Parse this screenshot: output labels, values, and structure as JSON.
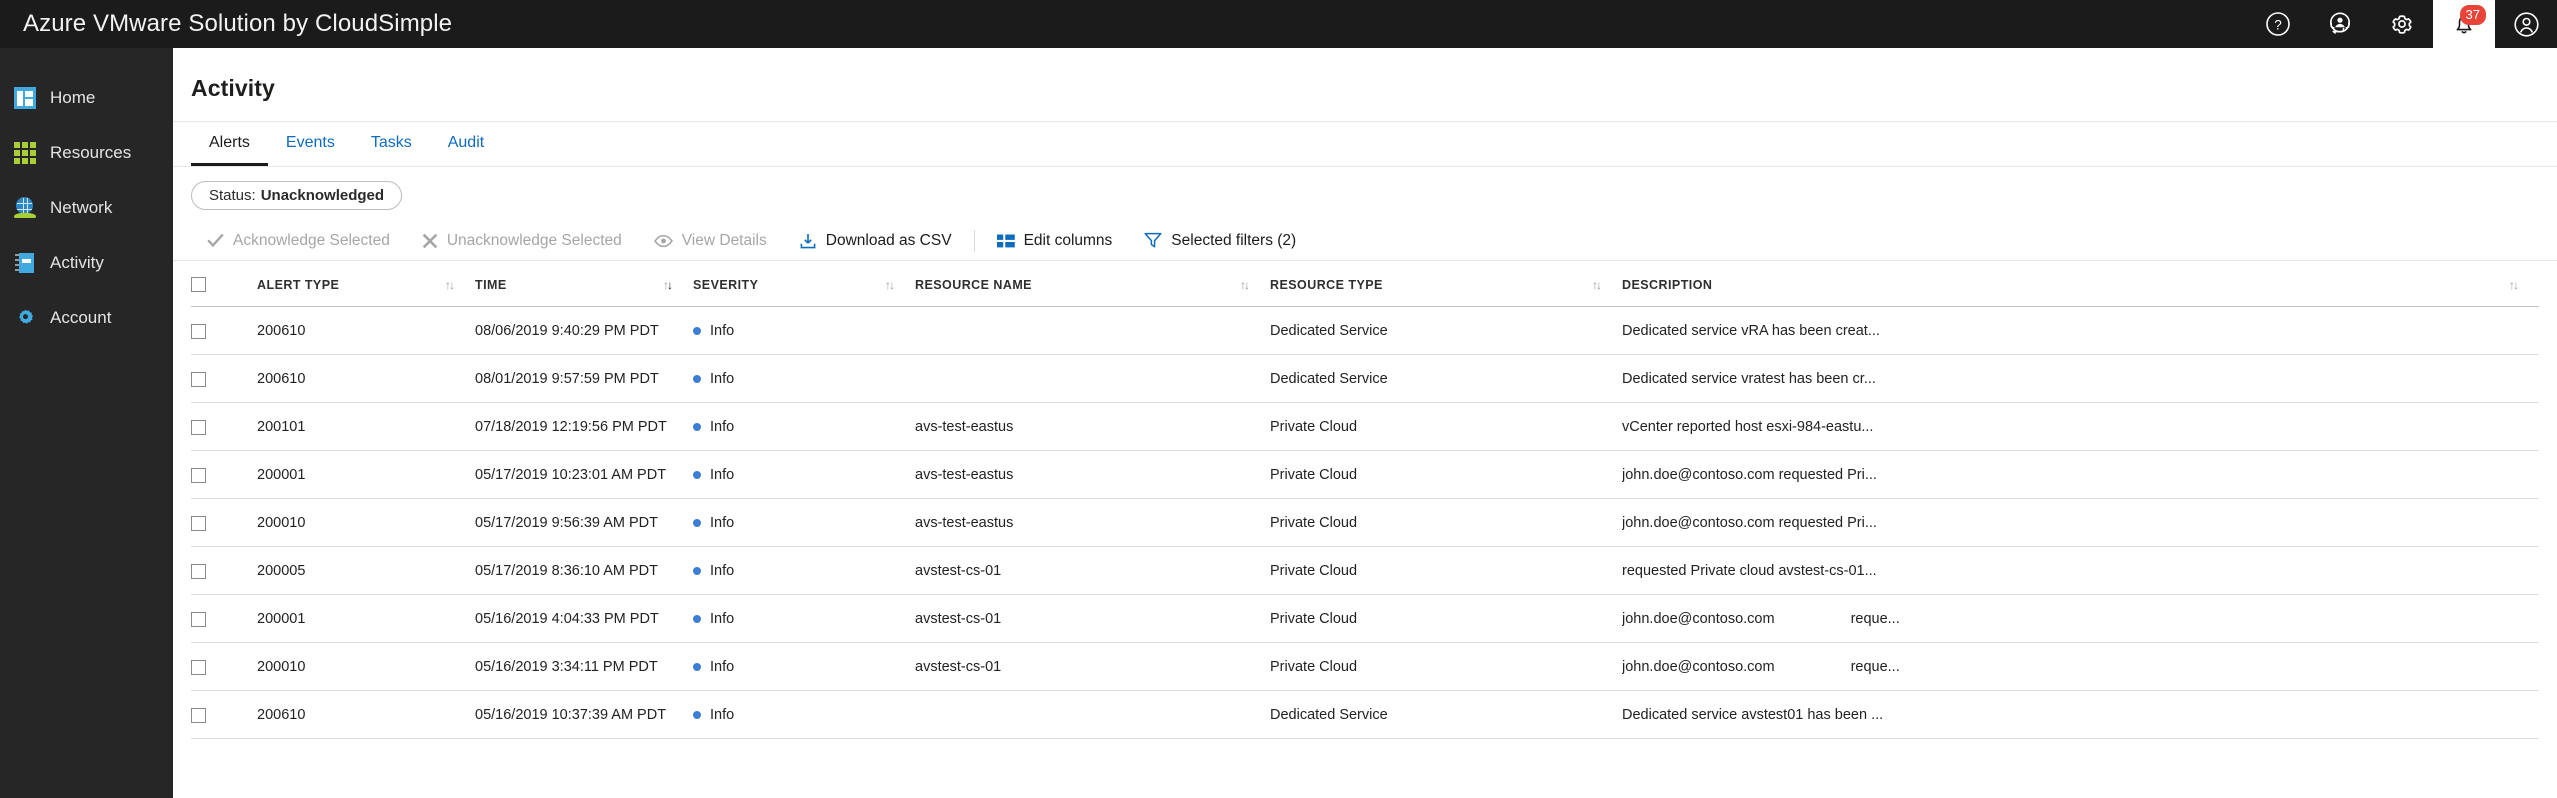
{
  "topbar": {
    "brand": "Azure VMware Solution by CloudSimple",
    "icons": [
      {
        "name": "help-icon",
        "glyph": "?"
      },
      {
        "name": "support-agent-icon",
        "glyph": ""
      },
      {
        "name": "settings-gear-icon",
        "glyph": ""
      },
      {
        "name": "notifications-bell-icon",
        "glyph": "",
        "badge": "37"
      },
      {
        "name": "user-account-icon",
        "glyph": ""
      }
    ],
    "notification_count": "37"
  },
  "sidebar": {
    "items": [
      {
        "label": "Home",
        "icon": "home-dashboard-icon"
      },
      {
        "label": "Resources",
        "icon": "resources-grid-icon"
      },
      {
        "label": "Network",
        "icon": "network-globe-icon"
      },
      {
        "label": "Activity",
        "icon": "activity-notebook-icon"
      },
      {
        "label": "Account",
        "icon": "account-gear-icon"
      }
    ]
  },
  "page": {
    "title": "Activity"
  },
  "tabs": [
    {
      "label": "Alerts",
      "active": true
    },
    {
      "label": "Events",
      "active": false
    },
    {
      "label": "Tasks",
      "active": false
    },
    {
      "label": "Audit",
      "active": false
    }
  ],
  "filter_chip": {
    "prefix": "Status:",
    "value": "Unacknowledged"
  },
  "toolbar": {
    "acknowledge_selected": "Acknowledge Selected",
    "unacknowledge_selected": "Unacknowledge Selected",
    "view_details": "View Details",
    "download_csv": "Download as CSV",
    "edit_columns": "Edit columns",
    "selected_filters": "Selected filters (2)"
  },
  "table": {
    "columns": [
      {
        "label": "ALERT TYPE",
        "sorted": false
      },
      {
        "label": "TIME",
        "sorted": true
      },
      {
        "label": "SEVERITY",
        "sorted": false
      },
      {
        "label": "RESOURCE NAME",
        "sorted": false
      },
      {
        "label": "RESOURCE TYPE",
        "sorted": false
      },
      {
        "label": "DESCRIPTION",
        "sorted": false
      }
    ],
    "rows": [
      {
        "alert_type": "200610",
        "time": "08/06/2019 9:40:29 PM PDT",
        "severity": "Info",
        "resource_name": "",
        "resource_type": "Dedicated Service",
        "description": "Dedicated service vRA has been creat...",
        "description_split": false
      },
      {
        "alert_type": "200610",
        "time": "08/01/2019 9:57:59 PM PDT",
        "severity": "Info",
        "resource_name": "",
        "resource_type": "Dedicated Service",
        "description": "Dedicated service vratest has been cr...",
        "description_split": false
      },
      {
        "alert_type": "200101",
        "time": "07/18/2019 12:19:56 PM PDT",
        "severity": "Info",
        "resource_name": "avs-test-eastus",
        "resource_type": "Private Cloud",
        "description": "vCenter reported host esxi-984-eastu...",
        "description_split": false
      },
      {
        "alert_type": "200001",
        "time": "05/17/2019 10:23:01 AM PDT",
        "severity": "Info",
        "resource_name": "avs-test-eastus",
        "resource_type": "Private Cloud",
        "description": "john.doe@contoso.com requested Pri...",
        "description_split": false
      },
      {
        "alert_type": "200010",
        "time": "05/17/2019 9:56:39 AM PDT",
        "severity": "Info",
        "resource_name": "avs-test-eastus",
        "resource_type": "Private Cloud",
        "description": "john.doe@contoso.com requested Pri...",
        "description_split": false
      },
      {
        "alert_type": "200005",
        "time": "05/17/2019 8:36:10 AM PDT",
        "severity": "Info",
        "resource_name": "avstest-cs-01",
        "resource_type": "Private Cloud",
        "description": "requested Private cloud avstest-cs-01...",
        "description_split": false
      },
      {
        "alert_type": "200001",
        "time": "05/16/2019 4:04:33 PM PDT",
        "severity": "Info",
        "resource_name": "avstest-cs-01",
        "resource_type": "Private Cloud",
        "description": "john.doe@contoso.com",
        "description_part2": "reque...",
        "description_split": true
      },
      {
        "alert_type": "200010",
        "time": "05/16/2019 3:34:11 PM PDT",
        "severity": "Info",
        "resource_name": "avstest-cs-01",
        "resource_type": "Private Cloud",
        "description": "john.doe@contoso.com",
        "description_part2": "reque...",
        "description_split": true
      },
      {
        "alert_type": "200610",
        "time": "05/16/2019 10:37:39 AM PDT",
        "severity": "Info",
        "resource_name": "",
        "resource_type": "Dedicated Service",
        "description": "Dedicated service avstest01 has been ...",
        "description_split": false
      }
    ]
  },
  "colors": {
    "topbar_bg": "#1b1b1b",
    "sidebar_bg": "#262626",
    "link_blue": "#0f6cbd",
    "badge_red": "#e8443a",
    "severity_info": "#3b7fd4"
  }
}
